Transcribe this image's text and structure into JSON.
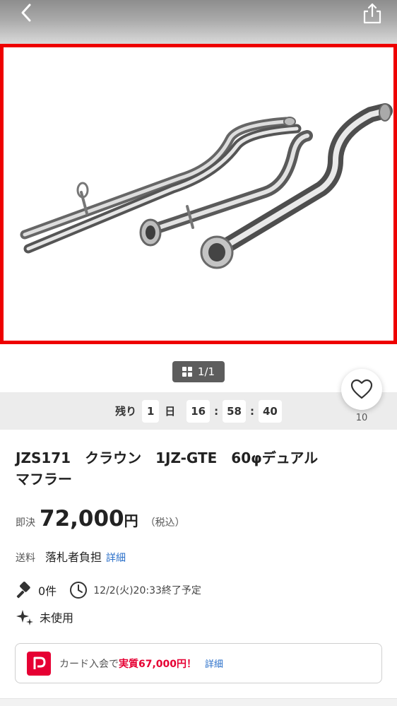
{
  "header": {
    "back_icon": "chevron-left-icon",
    "share_icon": "share-icon"
  },
  "gallery": {
    "counter": "1/1",
    "frame_color": "#ee0000"
  },
  "timer": {
    "prefix": "残り",
    "days": "1",
    "days_label": "日",
    "hours": "16",
    "minutes": "58",
    "seconds": "40",
    "separator": ":"
  },
  "favorite": {
    "icon": "heart-icon",
    "count": "10"
  },
  "item": {
    "title": "JZS171　クラウン　1JZ-GTE　60φデュアル\nマフラー",
    "price_label": "即決",
    "price": "72,000",
    "price_unit": "円",
    "tax_note": "（税込）",
    "shipping_label": "送料",
    "shipping_value": "落札者負担",
    "shipping_link": "詳細",
    "bids": "0件",
    "end_time": "12/2(火)20:33終了予定",
    "condition": "未使用"
  },
  "promo": {
    "text_prefix": "カード入会で",
    "highlight": "実質67,000円！",
    "link": "詳細",
    "brand_color": "#e60033"
  }
}
